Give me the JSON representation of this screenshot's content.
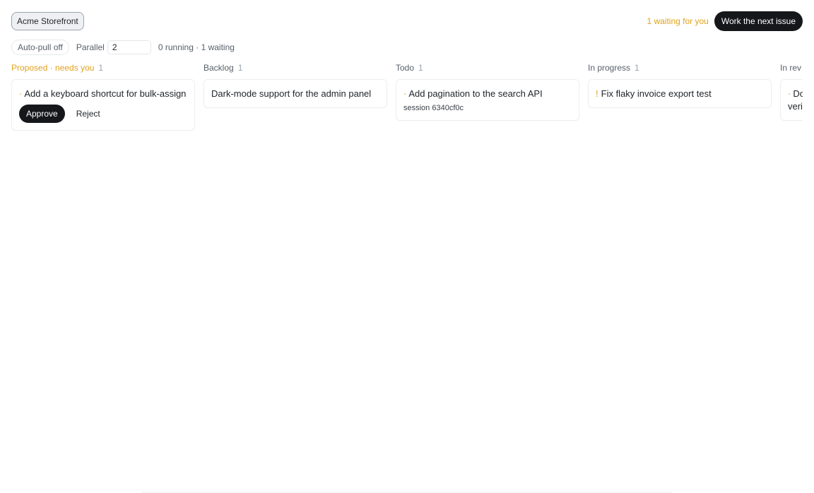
{
  "header": {
    "project": "Acme Storefront",
    "waiting_note": "1 waiting for you",
    "next_button": "Work the next issue"
  },
  "controls": {
    "auto_pull": "Auto-pull off",
    "parallel_label": "Parallel",
    "parallel_value": "2",
    "run_status": "0 running · 1 waiting"
  },
  "columns": [
    {
      "title": "Proposed · needs you",
      "count": "1",
      "cards": [
        {
          "priority": "·",
          "title": "Add a keyboard shortcut for bulk-assign",
          "approve": "Approve",
          "reject": "Reject"
        }
      ]
    },
    {
      "title": "Backlog",
      "count": "1",
      "cards": [
        {
          "title": "Dark-mode support for the admin panel"
        }
      ]
    },
    {
      "title": "Todo",
      "count": "1",
      "cards": [
        {
          "priority": "·",
          "title": "Add pagination to the search API",
          "session": "session 6340cf0c"
        }
      ]
    },
    {
      "title": "In progress",
      "count": "1",
      "cards": [
        {
          "priority": "!",
          "title": "Fix flaky invoice export test"
        }
      ]
    },
    {
      "title": "In rev",
      "count": "",
      "cards": [
        {
          "priority": "·",
          "title": "Do",
          "title_line2": "veri"
        }
      ]
    }
  ],
  "colors": {
    "accent_attention": "#e0a21c",
    "primary_button": "#15171a"
  }
}
